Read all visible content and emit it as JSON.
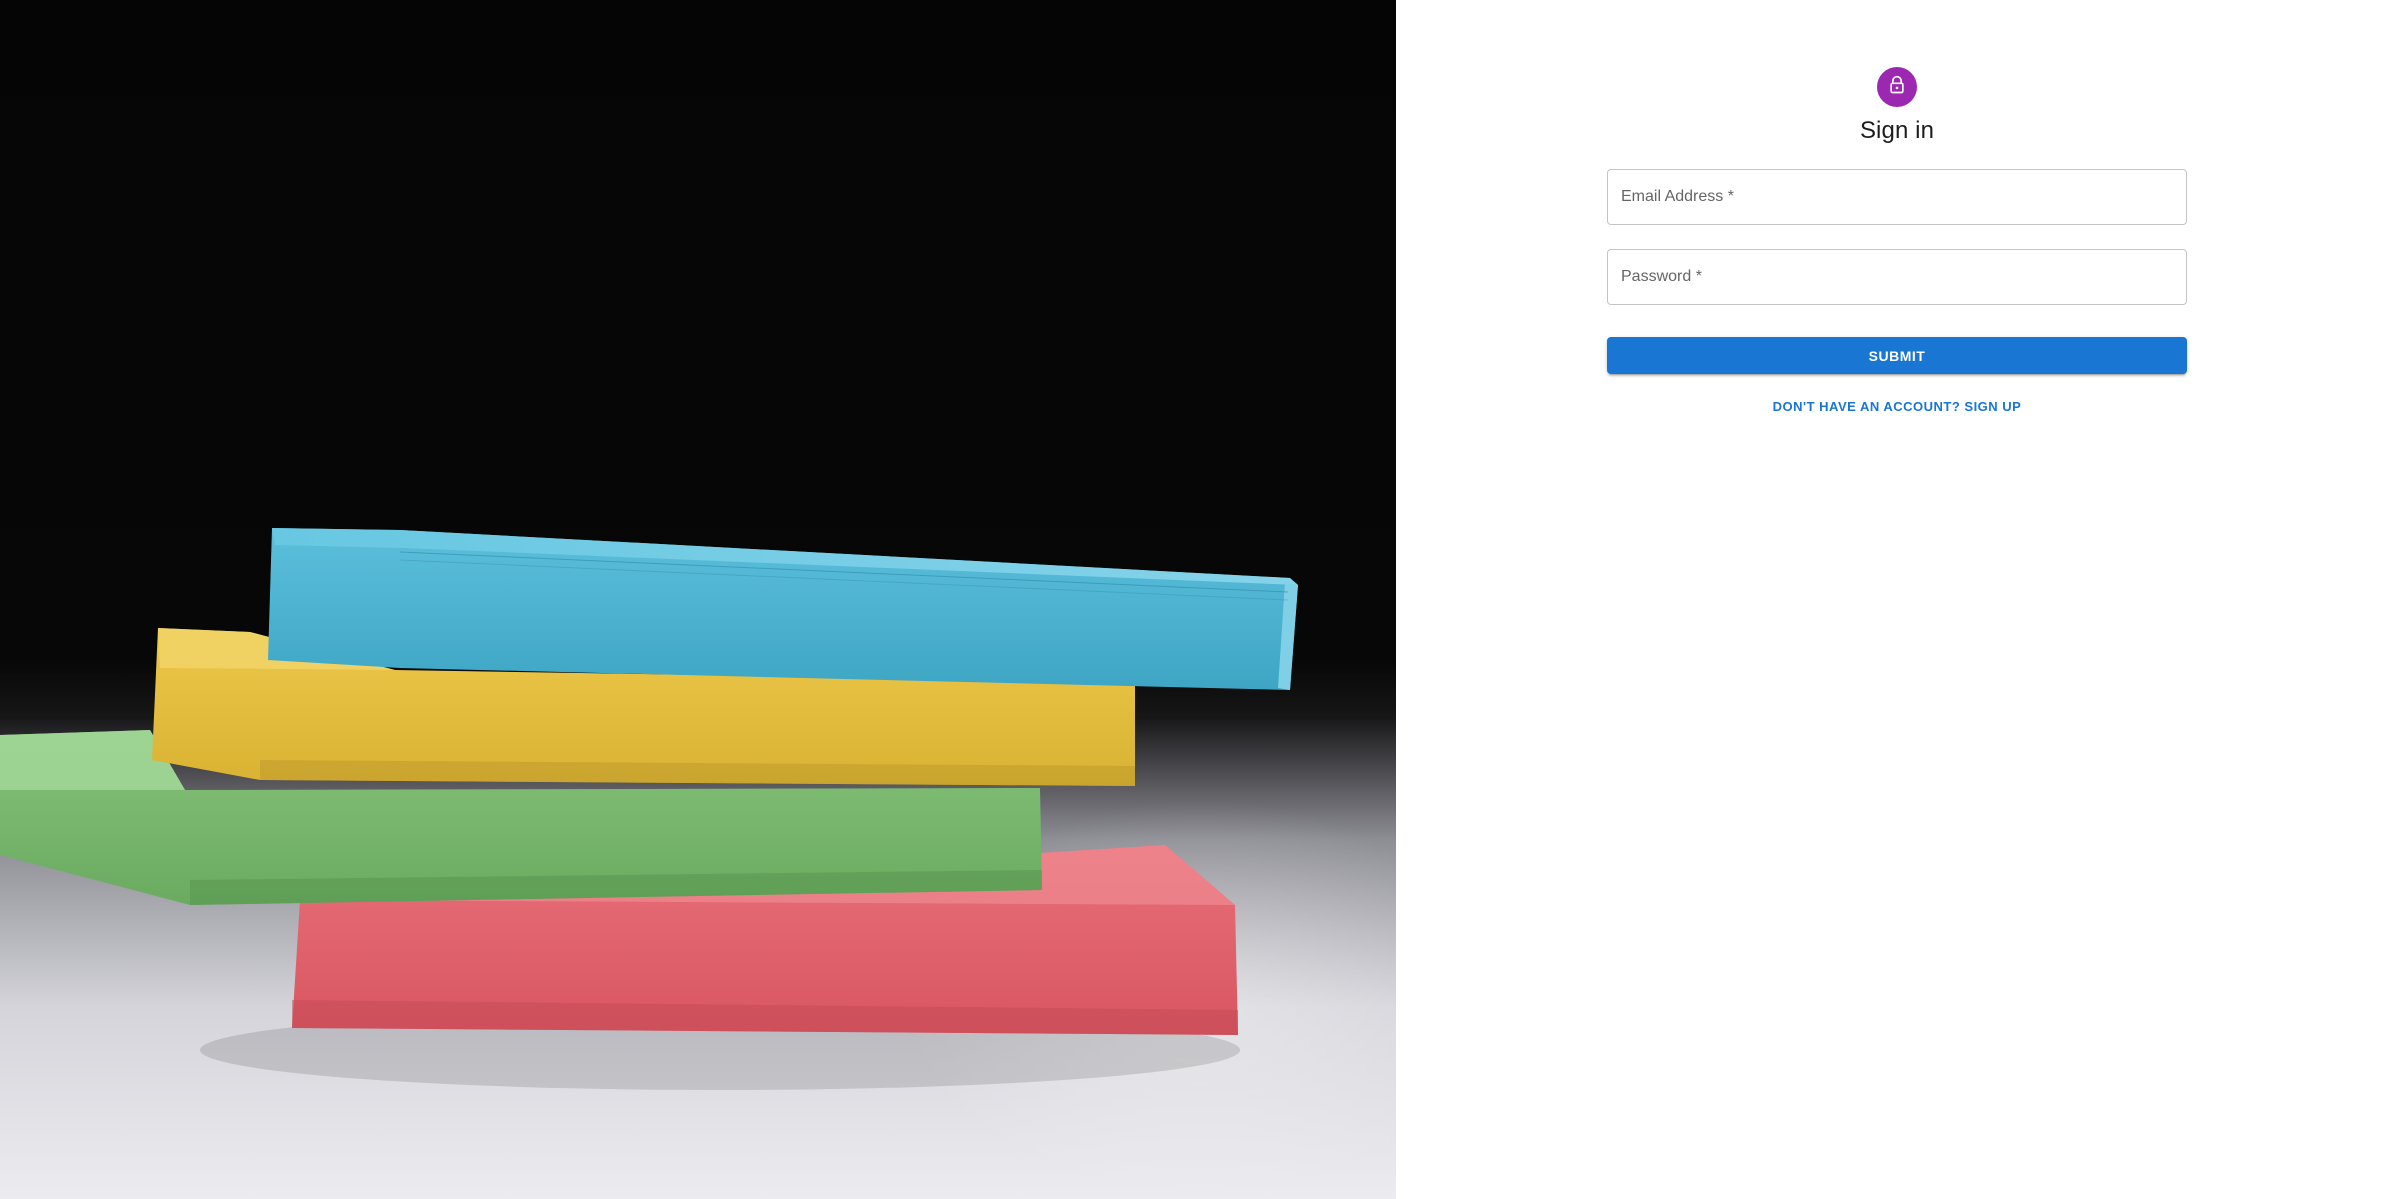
{
  "hero": {
    "image": "stack-of-sticky-notes-photo",
    "colors": {
      "blue_pad": "#4db3cf",
      "yellow_pad": "#e4c040",
      "green_pad": "#7fbf72",
      "pink_pad": "#e06568"
    }
  },
  "signin": {
    "icon": "lock-icon",
    "avatar_color": "#9c27b0",
    "title": "Sign in",
    "email": {
      "label": "Email Address *",
      "value": ""
    },
    "password": {
      "label": "Password *",
      "value": ""
    },
    "submit_label": "SUBMIT",
    "signup_link": "DON'T HAVE AN ACCOUNT? SIGN UP",
    "accent_color": "#1976d2"
  }
}
